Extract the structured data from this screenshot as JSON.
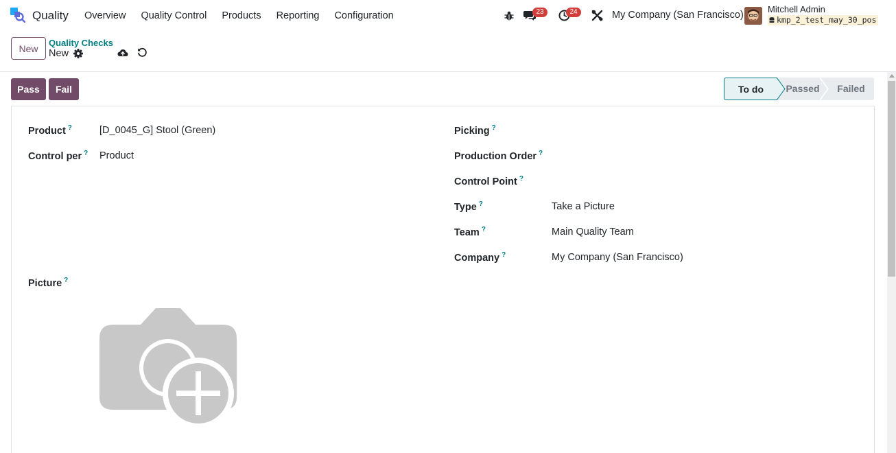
{
  "app": {
    "name": "Quality",
    "menu": [
      "Overview",
      "Quality Control",
      "Products",
      "Reporting",
      "Configuration"
    ]
  },
  "systray": {
    "messages_count": "23",
    "activities_count": "24",
    "company": "My Company (San Francisco)",
    "user_name": "Mitchell Admin",
    "database": "kmp_2_test_may_30_pos"
  },
  "control_panel": {
    "new_label": "New",
    "breadcrumb": "Quality Checks",
    "record_name": "New"
  },
  "actions": {
    "pass_label": "Pass",
    "fail_label": "Fail"
  },
  "statusbar": {
    "stages": [
      "To do",
      "Passed",
      "Failed"
    ],
    "current": "To do"
  },
  "form": {
    "left": [
      {
        "label": "Product",
        "value": "[D_0045_G] Stool (Green)"
      },
      {
        "label": "Control per",
        "value": "Product"
      }
    ],
    "right": [
      {
        "label": "Picking",
        "value": ""
      },
      {
        "label": "Production Order",
        "value": ""
      },
      {
        "label": "Control Point",
        "value": ""
      },
      {
        "label": "Type",
        "value": "Take a Picture"
      },
      {
        "label": "Team",
        "value": "Main Quality Team"
      },
      {
        "label": "Company",
        "value": "My Company (San Francisco)"
      }
    ],
    "picture_label": "Picture",
    "help_mark": "?"
  },
  "colors": {
    "brand": "#714b67",
    "teal": "#017e84",
    "badge": "#d23f3a"
  }
}
